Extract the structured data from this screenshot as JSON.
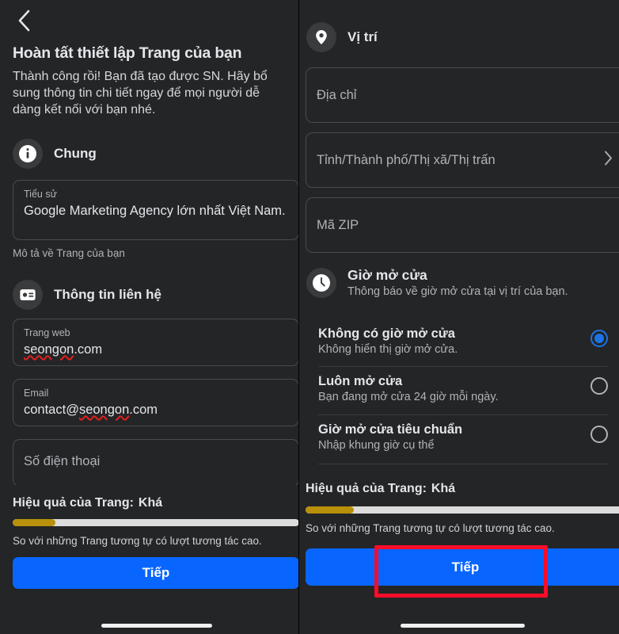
{
  "meta": {
    "bg_color": "#18191a",
    "panel_color": "#242526",
    "accent_blue": "#0866ff",
    "radio_blue": "#1b74e4",
    "progress_fill": "#b8900a",
    "progress_track": "#dcdcdc",
    "annotation_color": "#fb0d2a"
  },
  "left_panel": {
    "back_label": "Quay lại",
    "title": "Hoàn tất thiết lập Trang của bạn",
    "subtitle": "Thành công rồi! Bạn đã tạo được SN. Hãy bổ sung thông tin chi tiết ngay để mọi người dễ dàng kết nối với bạn nhé.",
    "sections": [
      {
        "icon": "info-icon",
        "title": "Chung"
      },
      {
        "icon": "contact-card-icon",
        "title": "Thông tin liên hệ"
      }
    ],
    "bio_field": {
      "label": "Tiểu sử",
      "value": "Google Marketing Agency lớn nhất Việt Nam.",
      "helper": "Mô tả về Trang của bạn"
    },
    "website_field": {
      "label": "Trang web",
      "value": "seongon",
      "value_suffix": ".com"
    },
    "email_field": {
      "label": "Email",
      "value_prefix": "contact@",
      "value": "seongon",
      "value_suffix": ".com"
    },
    "phone_field": {
      "placeholder": "Số điện thoại"
    },
    "performance": {
      "label": "Hiệu quả của Trang:",
      "value": "Khá",
      "progress_percent": 15,
      "note": "So với những Trang tương tự có lượt tương tác cao."
    },
    "next_button": "Tiếp"
  },
  "right_panel": {
    "location_section": {
      "icon": "location-pin-icon",
      "title": "Vị trí"
    },
    "address_field": {
      "placeholder": "Địa chỉ"
    },
    "city_field": {
      "placeholder": "Tỉnh/Thành phố/Thị xã/Thị trấn",
      "chevron": "chevron-right-icon"
    },
    "zip_field": {
      "placeholder": "Mã ZIP"
    },
    "hours_section": {
      "icon": "clock-icon",
      "title": "Giờ mở cửa",
      "description": "Thông báo về giờ mở cửa tại vị trí của bạn."
    },
    "hours_options": [
      {
        "title": "Không có giờ mở cửa",
        "sub": "Không hiển thị giờ mở cửa.",
        "selected": true
      },
      {
        "title": "Luôn mở cửa",
        "sub": "Bạn đang mở cửa 24 giờ mỗi ngày.",
        "selected": false
      },
      {
        "title": "Giờ mở cửa tiêu chuẩn",
        "sub": "Nhập khung giờ cụ thể",
        "selected": false
      }
    ],
    "performance": {
      "label": "Hiệu quả của Trang:",
      "value": "Khá",
      "progress_percent": 15,
      "note": "So với những Trang tương tự có lượt tương tác cao."
    },
    "next_button": "Tiếp"
  }
}
